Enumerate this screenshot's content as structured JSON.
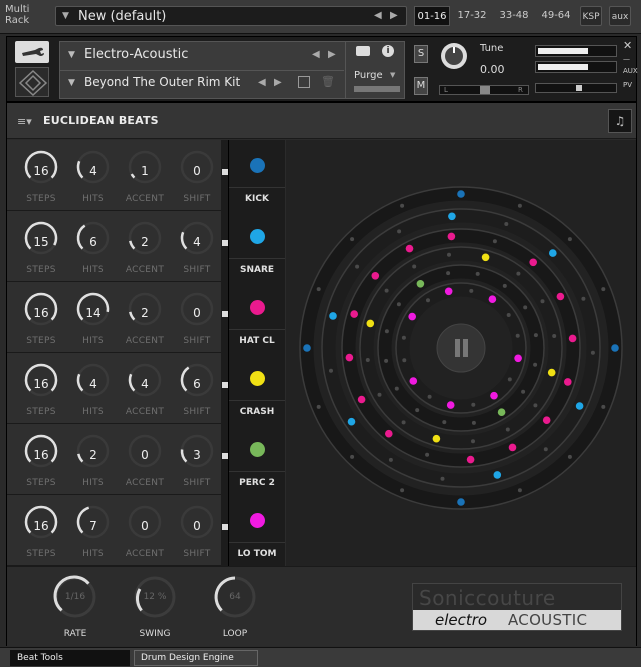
{
  "rack": {
    "label_line1": "Multi",
    "label_line2": "Rack",
    "preset_name": "New (default)",
    "page_buttons": [
      "01-16",
      "17-32",
      "33-48",
      "49-64"
    ],
    "ksp_label": "KSP",
    "aux_label": "aux"
  },
  "header": {
    "instrument_name": "Electro-Acoustic",
    "snapshot_name": "Beyond The Outer Rim Kit",
    "purge_label": "Purge",
    "solo_label": "S",
    "mute_label": "M",
    "tune_label": "Tune",
    "tune_value": "0.00",
    "pan_left_label": "L",
    "pan_right_label": "R",
    "aux_mini": "AUX",
    "pv_mini": "PV"
  },
  "panel": {
    "title": "EUCLIDEAN BEATS"
  },
  "knob_labels": {
    "steps": "STEPS",
    "hits": "HITS",
    "accent": "ACCENT",
    "shift": "SHIFT"
  },
  "tracks": [
    {
      "name": "KICK",
      "color": "#1a73b8",
      "steps": "16",
      "hits": "4",
      "accent": "1",
      "shift": "0"
    },
    {
      "name": "SNARE",
      "color": "#1fa6e6",
      "steps": "15",
      "hits": "6",
      "accent": "2",
      "shift": "4"
    },
    {
      "name": "HAT CL",
      "color": "#ea1a8e",
      "steps": "16",
      "hits": "14",
      "accent": "2",
      "shift": "0"
    },
    {
      "name": "CRASH",
      "color": "#f0e014",
      "steps": "16",
      "hits": "4",
      "accent": "4",
      "shift": "6"
    },
    {
      "name": "PERC 2",
      "color": "#78b85a",
      "steps": "16",
      "hits": "2",
      "accent": "0",
      "shift": "3"
    },
    {
      "name": "LO TOM",
      "color": "#f01ae0",
      "steps": "16",
      "hits": "7",
      "accent": "0",
      "shift": "0"
    }
  ],
  "bottom_knobs": [
    {
      "label": "RATE",
      "value": "1/16"
    },
    {
      "label": "SWING",
      "value": "12 %"
    },
    {
      "label": "LOOP",
      "value": "64"
    }
  ],
  "brand": {
    "top": "Soniccouture",
    "bottom_italic": "electro",
    "bottom_caps": "ACOUSTIC"
  },
  "tabs": {
    "beat_tools": "Beat Tools",
    "drum_design": "Drum Design Engine"
  },
  "colors": {
    "accent_white": "#dddddd",
    "ring_dark": "#1f1f1f",
    "ring_light": "#3a3a3a"
  }
}
